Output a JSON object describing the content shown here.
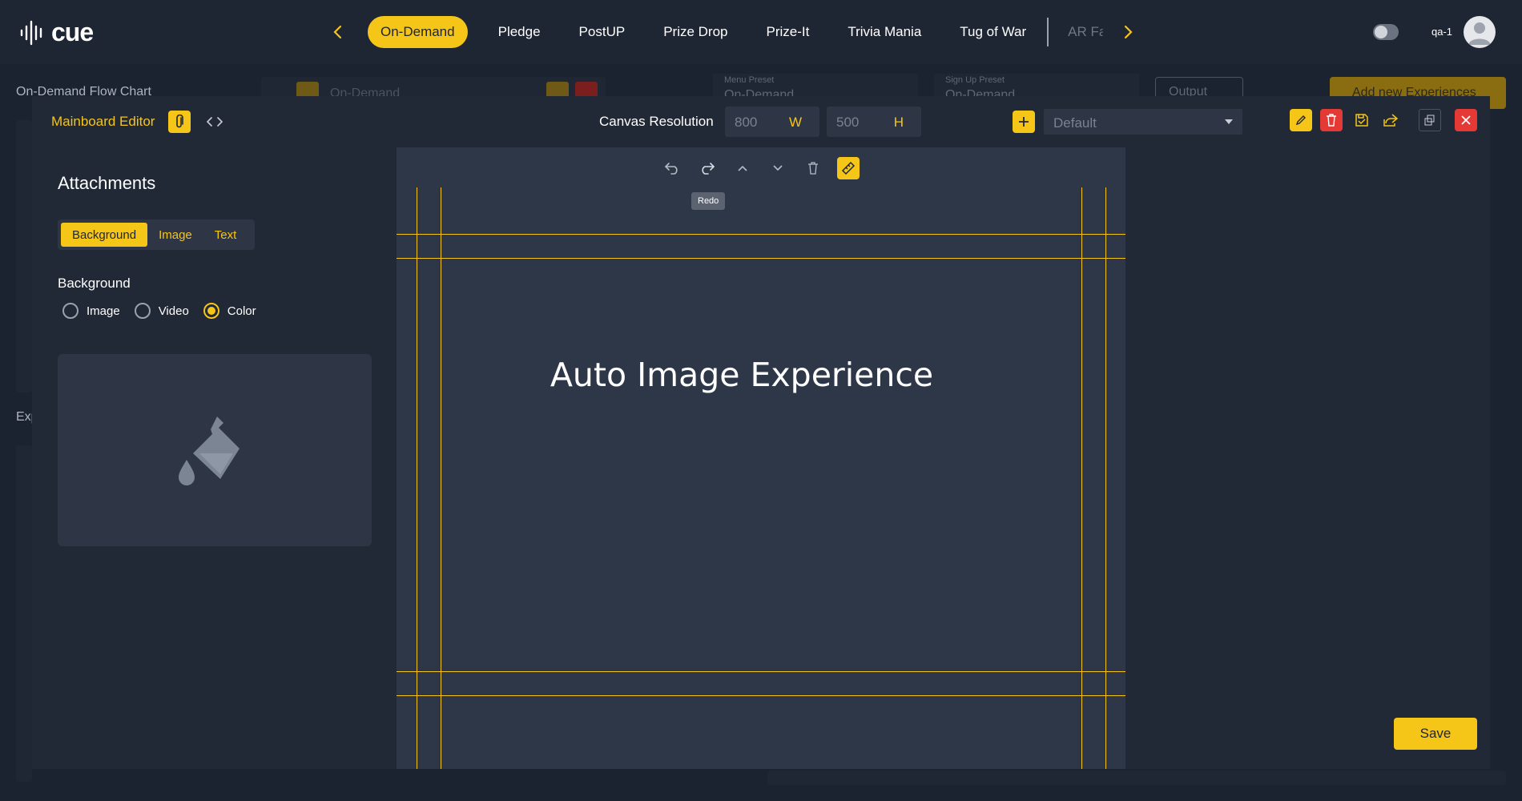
{
  "app": {
    "logo_text": "cue"
  },
  "nav": {
    "tabs": [
      "On-Demand",
      "Pledge",
      "PostUP",
      "Prize Drop",
      "Prize-It",
      "Trivia Mania",
      "Tug of War"
    ],
    "overflow_tab": "AR Fa",
    "user": "qa-1"
  },
  "background_page": {
    "title": "On-Demand Flow Chart",
    "flow_select": "On-Demand",
    "menu_preset": {
      "label": "Menu Preset",
      "value": "On-Demand"
    },
    "signup_preset": {
      "label": "Sign Up Preset",
      "value": "On-Demand"
    },
    "output_label": "Output",
    "add_button": "Add new Experiences",
    "section_label": "Exp"
  },
  "modal": {
    "title": "Mainboard Editor",
    "canvas_resolution_label": "Canvas Resolution",
    "width": {
      "value": "800",
      "unit": "W"
    },
    "height": {
      "value": "500",
      "unit": "H"
    },
    "preset": "Default",
    "save_label": "Save"
  },
  "attachments": {
    "title": "Attachments",
    "tabs": [
      "Background",
      "Image",
      "Text"
    ],
    "active_tab": "Background",
    "background_label": "Background",
    "options": [
      "Image",
      "Video",
      "Color"
    ],
    "selected_option": "Color"
  },
  "canvas": {
    "tooltip": "Redo",
    "text": "Auto Image Experience"
  },
  "colors": {
    "accent": "#f5c518",
    "danger": "#e53935",
    "page_bg": "#1b2230",
    "modal_bg": "#212836",
    "canvas_bg": "#2d3748"
  }
}
